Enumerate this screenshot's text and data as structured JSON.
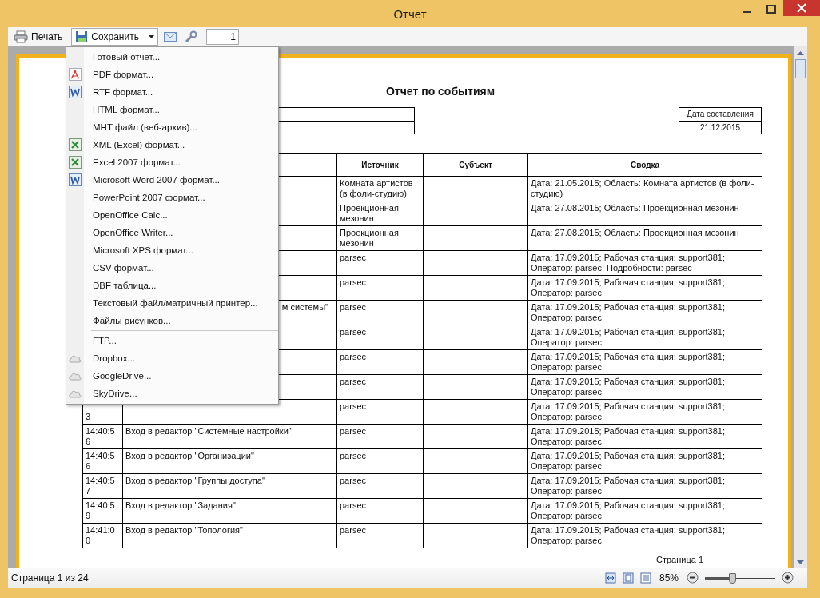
{
  "window": {
    "title": "Отчет"
  },
  "toolbar": {
    "print": "Печать",
    "save": "Сохранить",
    "page_input": "1"
  },
  "save_menu": {
    "sections": [
      {
        "items": [
          {
            "label": "Готовый отчет...",
            "kind": "plain"
          },
          {
            "label": "PDF формат...",
            "kind": "pdf"
          },
          {
            "label": "RTF формат...",
            "kind": "word"
          },
          {
            "label": "HTML формат...",
            "kind": "plain"
          },
          {
            "label": "MHT файл (веб-архив)...",
            "kind": "plain"
          },
          {
            "label": "XML (Excel) формат...",
            "kind": "excel"
          },
          {
            "label": "Excel 2007 формат...",
            "kind": "excel"
          },
          {
            "label": "Microsoft Word 2007 формат...",
            "kind": "word"
          },
          {
            "label": "PowerPoint 2007 формат...",
            "kind": "plain"
          },
          {
            "label": "OpenOffice Calc...",
            "kind": "plain"
          },
          {
            "label": "OpenOffice Writer...",
            "kind": "plain"
          },
          {
            "label": "Microsoft XPS формат...",
            "kind": "plain"
          },
          {
            "label": "CSV формат...",
            "kind": "plain"
          },
          {
            "label": "DBF таблица...",
            "kind": "plain"
          },
          {
            "label": "Текстовый файл/матричный принтер...",
            "kind": "plain"
          },
          {
            "label": "Файлы рисунков...",
            "kind": "plain"
          }
        ]
      },
      {
        "items": [
          {
            "label": "FTP...",
            "kind": "plain"
          },
          {
            "label": "Dropbox...",
            "kind": "cloud"
          },
          {
            "label": "GoogleDrive...",
            "kind": "cloud"
          },
          {
            "label": "SkyDrive...",
            "kind": "cloud"
          }
        ]
      }
    ]
  },
  "report": {
    "title": "Отчет по событиям",
    "date_label": "Дата составления",
    "date": "21.12.2015",
    "columns": [
      "Источник",
      "Субъект",
      "Сводка"
    ],
    "rows": [
      {
        "source": "Комната артистов (в фоли-студию)",
        "summary": "Дата: 21.05.2015; Область: Комната артистов (в фоли-студию)"
      },
      {
        "source": "Проекционная мезонин",
        "summary": "Дата: 27.08.2015; Область: Проекционная мезонин"
      },
      {
        "source": "Проекционная мезонин",
        "summary": "Дата: 27.08.2015; Область: Проекционная мезонин"
      },
      {
        "source": "parsec",
        "summary": "Дата: 17.09.2015; Рабочая станция: support381; Оператор: parsec; Подробности: parsec"
      },
      {
        "source": "parsec",
        "summary": "Дата: 17.09.2015; Рабочая станция: support381; Оператор: parsec"
      },
      {
        "event": "м системы\"",
        "clipped": true,
        "source": "parsec",
        "summary": "Дата: 17.09.2015; Рабочая станция: support381; Оператор: parsec"
      },
      {
        "source": "parsec",
        "summary": "Дата: 17.09.2015; Рабочая станция: support381; Оператор: parsec"
      },
      {
        "source": "parsec",
        "summary": "Дата: 17.09.2015; Рабочая станция: support381; Оператор: parsec"
      },
      {
        "source": "parsec",
        "summary": "Дата: 17.09.2015; Рабочая станция: support381; Оператор: parsec"
      },
      {
        "time": "3",
        "clipped": true,
        "source": "parsec",
        "summary": "Дата: 17.09.2015; Рабочая станция: support381; Оператор: parsec"
      },
      {
        "time": "14:40:56",
        "event": "Вход в редактор \"Системные настройки\"",
        "source": "parsec",
        "summary": "Дата: 17.09.2015; Рабочая станция: support381; Оператор: parsec"
      },
      {
        "time": "14:40:56",
        "event": "Вход в редактор \"Организации\"",
        "source": "parsec",
        "summary": "Дата: 17.09.2015; Рабочая станция: support381; Оператор: parsec"
      },
      {
        "time": "14:40:57",
        "event": "Вход в редактор \"Группы доступа\"",
        "source": "parsec",
        "summary": "Дата: 17.09.2015; Рабочая станция: support381; Оператор: parsec"
      },
      {
        "time": "14:40:59",
        "event": "Вход в редактор \"Задания\"",
        "source": "parsec",
        "summary": "Дата: 17.09.2015; Рабочая станция: support381; Оператор: parsec"
      },
      {
        "time": "14:41:00",
        "event": "Вход в редактор \"Топология\"",
        "source": "parsec",
        "summary": "Дата: 17.09.2015; Рабочая станция: support381; Оператор: parsec"
      }
    ],
    "page_footer": "Страница 1"
  },
  "status_bar": {
    "page_info": "Страница 1 из 24",
    "zoom": "85%",
    "zoom_slider": {
      "level": 0.38
    }
  }
}
